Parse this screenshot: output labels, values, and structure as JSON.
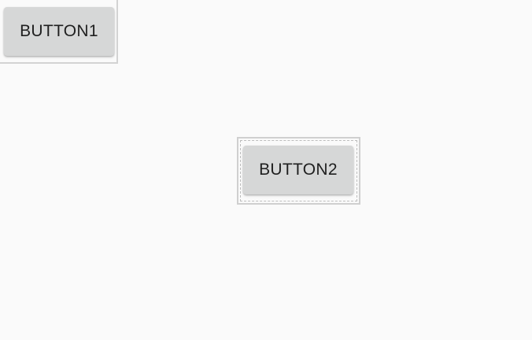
{
  "buttons": {
    "button1": {
      "label": "BUTTON1"
    },
    "button2": {
      "label": "BUTTON2"
    }
  },
  "colors": {
    "background": "#fafafa",
    "button_fill": "#d6d7d7",
    "button_text": "#1f1f1f",
    "frame_border": "#d3d3d3"
  }
}
